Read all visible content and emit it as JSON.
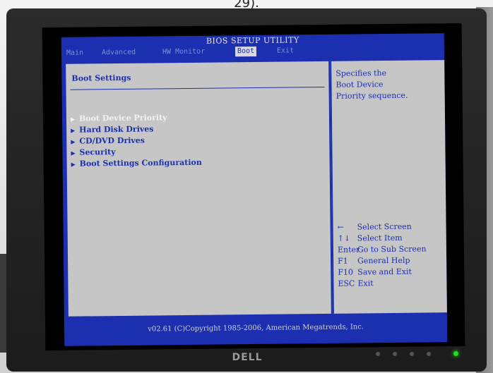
{
  "caption": "29).",
  "title": "BIOS SETUP UTILITY",
  "menu": [
    {
      "label": "Main",
      "active": false
    },
    {
      "label": "Advanced",
      "active": false
    },
    {
      "label": "HW Monitor",
      "active": false
    },
    {
      "label": "Boot",
      "active": true
    },
    {
      "label": "Exit",
      "active": false
    }
  ],
  "main_panel": {
    "title": "Boot Settings",
    "items": [
      {
        "label": "Boot Device Priority",
        "selected": true
      },
      {
        "label": "Hard Disk Drives",
        "selected": false
      },
      {
        "label": "CD/DVD Drives",
        "selected": false
      },
      {
        "label": "Security",
        "selected": false
      },
      {
        "label": "Boot Settings Configuration",
        "selected": false
      }
    ]
  },
  "help_panel": {
    "lines": [
      "Specifies the",
      "Boot Device",
      "Priority sequence."
    ],
    "keys": [
      {
        "key": "←",
        "action": "Select Screen"
      },
      {
        "key": "↑↓",
        "action": "Select Item"
      },
      {
        "key": "Enter",
        "action": "Go to Sub Screen"
      },
      {
        "key": "F1",
        "action": "General Help"
      },
      {
        "key": "F10",
        "action": "Save and Exit"
      },
      {
        "key": "ESC",
        "action": "Exit"
      }
    ]
  },
  "status_bar": "v02.61 (C)Copyright 1985-2006, American Megatrends, Inc.",
  "brand": "DELL",
  "colors": {
    "bios_blue": "#1b2fb0",
    "panel_gray": "#c6c6c6",
    "power_led": "#22dd22"
  }
}
